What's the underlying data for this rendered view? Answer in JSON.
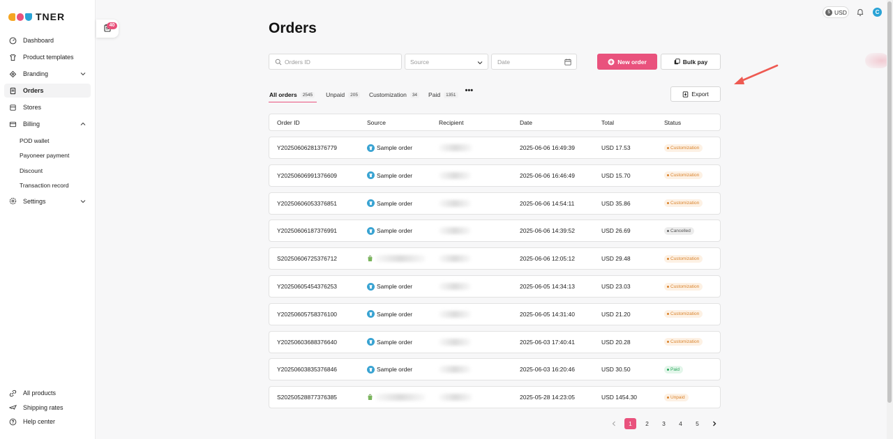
{
  "brand": {
    "logo_text": "TNER",
    "logo_colors": [
      "#f5a623",
      "#e9527d",
      "#2aa3d6"
    ]
  },
  "sidebar": {
    "items": [
      {
        "label": "Dashboard",
        "icon": "dashboard-icon"
      },
      {
        "label": "Product templates",
        "icon": "shirt-icon"
      },
      {
        "label": "Branding",
        "icon": "tag-icon",
        "expandable": true
      },
      {
        "label": "Orders",
        "icon": "orders-icon",
        "active": true
      },
      {
        "label": "Stores",
        "icon": "store-icon"
      },
      {
        "label": "Billing",
        "icon": "wallet-icon",
        "expanded": true
      }
    ],
    "billing_sub": [
      "POD wallet",
      "Payoneer payment",
      "Discount",
      "Transaction record"
    ],
    "settings_label": "Settings",
    "bottom": [
      "All products",
      "Shipping rates",
      "Help center"
    ]
  },
  "task_badge": "40",
  "topbar": {
    "currency": "USD",
    "avatar": "C"
  },
  "page": {
    "title": "Orders"
  },
  "filters": {
    "search_placeholder": "Orders ID",
    "source_placeholder": "Source",
    "date_placeholder": "Date"
  },
  "actions": {
    "new_order": "New order",
    "bulk_pay": "Bulk pay",
    "export": "Export"
  },
  "tabs": [
    {
      "label": "All orders",
      "count": "2545",
      "active": true
    },
    {
      "label": "Unpaid",
      "count": "205"
    },
    {
      "label": "Customization",
      "count": "34"
    },
    {
      "label": "Paid",
      "count": "1351"
    }
  ],
  "table": {
    "headers": [
      "Order ID",
      "Source",
      "Recipient",
      "Date",
      "Total",
      "Status"
    ],
    "rows": [
      {
        "id": "Y20250606281376779",
        "source": "Sample order",
        "source_type": "sample",
        "date": "2025-06-06 16:49:39",
        "total": "USD 17.53",
        "status": "Customization",
        "status_type": "custom"
      },
      {
        "id": "Y20250606991376609",
        "source": "Sample order",
        "source_type": "sample",
        "date": "2025-06-06 16:46:49",
        "total": "USD 15.70",
        "status": "Customization",
        "status_type": "custom"
      },
      {
        "id": "Y20250606053376851",
        "source": "Sample order",
        "source_type": "sample",
        "date": "2025-06-06 14:54:11",
        "total": "USD 35.86",
        "status": "Customization",
        "status_type": "custom"
      },
      {
        "id": "Y20250606187376991",
        "source": "Sample order",
        "source_type": "sample",
        "date": "2025-06-06 14:39:52",
        "total": "USD 26.69",
        "status": "Cancelled",
        "status_type": "cancel"
      },
      {
        "id": "S20250606725376712",
        "source": "",
        "source_type": "shopify",
        "date": "2025-06-06 12:05:12",
        "total": "USD 29.48",
        "status": "Customization",
        "status_type": "custom"
      },
      {
        "id": "Y20250605454376253",
        "source": "Sample order",
        "source_type": "sample",
        "date": "2025-06-05 14:34:13",
        "total": "USD 23.03",
        "status": "Customization",
        "status_type": "custom"
      },
      {
        "id": "Y20250605758376100",
        "source": "Sample order",
        "source_type": "sample",
        "date": "2025-06-05 14:31:40",
        "total": "USD 21.20",
        "status": "Customization",
        "status_type": "custom"
      },
      {
        "id": "Y20250603688376640",
        "source": "Sample order",
        "source_type": "sample",
        "date": "2025-06-03 17:40:41",
        "total": "USD 20.28",
        "status": "Customization",
        "status_type": "custom"
      },
      {
        "id": "Y20250603835376846",
        "source": "Sample order",
        "source_type": "sample",
        "date": "2025-06-03 16:20:46",
        "total": "USD 30.50",
        "status": "Paid",
        "status_type": "paid"
      },
      {
        "id": "S20250528877376385",
        "source": "",
        "source_type": "shopify",
        "date": "2025-05-28 14:23:05",
        "total": "USD 1454.30",
        "status": "Unpaid",
        "status_type": "unpaid"
      }
    ]
  },
  "pagination": {
    "pages": [
      "1",
      "2",
      "3",
      "4",
      "5"
    ],
    "current": "1"
  },
  "colors": {
    "accent": "#e9527d",
    "customization": "#d9822b",
    "paid": "#27a55a",
    "annotation_arrow": "#ee5a52"
  }
}
